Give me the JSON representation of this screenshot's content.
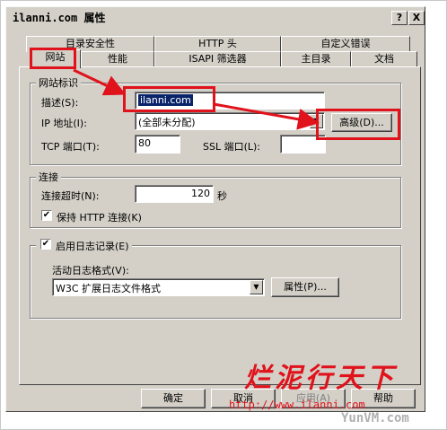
{
  "window": {
    "title": "ilanni.com 属性",
    "help_btn": "?",
    "close_btn": "X"
  },
  "tabs_row1": [
    "目录安全性",
    "HTTP 头",
    "自定义错误"
  ],
  "tabs_row2": [
    "网站",
    "性能",
    "ISAPI 筛选器",
    "主目录",
    "文档"
  ],
  "site_id": {
    "legend": "网站标识",
    "desc_label": "描述(S):",
    "desc_value": "ilanni.com",
    "ip_label": "IP 地址(I):",
    "ip_value": "(全部未分配)",
    "advanced_btn": "高级(D)...",
    "tcp_label": "TCP 端口(T):",
    "tcp_value": "80",
    "ssl_label": "SSL 端口(L):",
    "ssl_value": ""
  },
  "connection": {
    "legend": "连接",
    "timeout_label": "连接超时(N):",
    "timeout_value": "120",
    "timeout_unit": "秒",
    "keepalive_label": "保持 HTTP 连接(K)"
  },
  "logging": {
    "enable_label": "启用日志记录(E)",
    "format_label": "活动日志格式(V):",
    "format_value": "W3C 扩展日志文件格式",
    "props_btn": "属性(P)..."
  },
  "buttons": {
    "ok": "确定",
    "cancel": "取消",
    "apply": "应用(A)",
    "help": "帮助"
  },
  "watermark": {
    "cn": "烂泥行天下",
    "url": "http://www.ilanni.com",
    "brand": "YunVM.com"
  },
  "colors": {
    "highlight": "#e0121b",
    "dialog": "#d4d0c8",
    "selection": "#0a246a"
  }
}
